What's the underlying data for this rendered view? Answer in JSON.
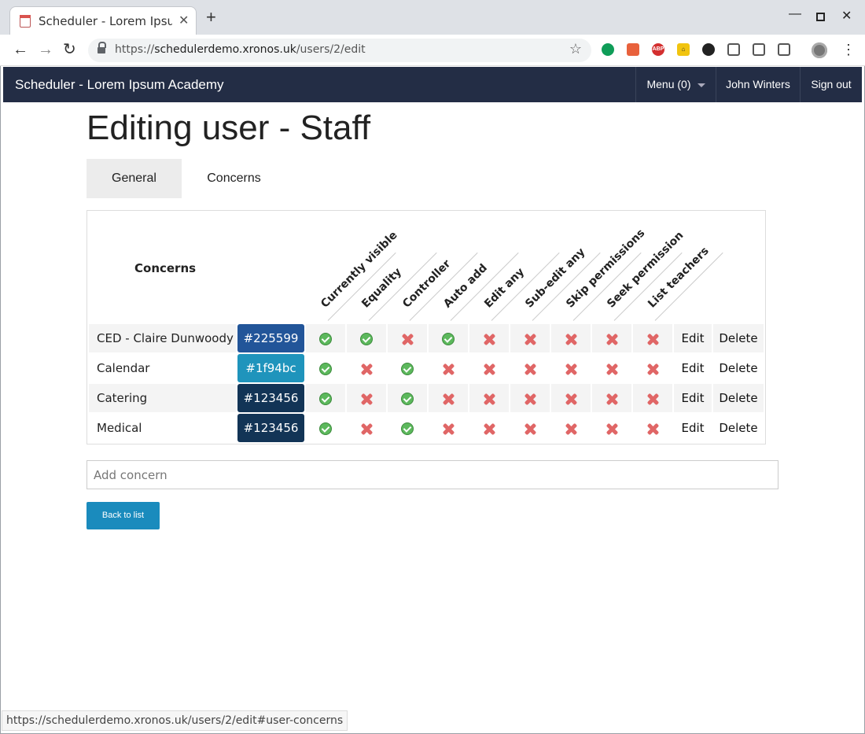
{
  "browser": {
    "tab_title": "Scheduler - Lorem Ipsum A",
    "url_scheme": "https://",
    "url_host": "schedulerdemo.xronos.uk",
    "url_path": "/users/2/edit",
    "status_url": "https://schedulerdemo.xronos.uk/users/2/edit#user-concerns",
    "extension_icons": [
      "evernote-icon",
      "pdf-icon",
      "adblock-icon",
      "house-icon",
      "paw-icon",
      "bulb-icon",
      "mail-icon",
      "screenshot-icon"
    ]
  },
  "navbar": {
    "brand": "Scheduler - Lorem Ipsum Academy",
    "menu_label": "Menu (0)",
    "user_label": "John Winters",
    "signout_label": "Sign out",
    "background": "#232d45"
  },
  "page": {
    "title": "Editing user - Staff",
    "tabs": [
      {
        "label": "General",
        "active": true
      },
      {
        "label": "Concerns",
        "active": false
      }
    ]
  },
  "concerns_table": {
    "header": "Concerns",
    "columns": [
      "Currently visible",
      "Equality",
      "Controller",
      "Auto add",
      "Edit any",
      "Sub-edit any",
      "Skip permissions",
      "Seek permission",
      "List teachers"
    ],
    "edit_label": "Edit",
    "delete_label": "Delete",
    "rows": [
      {
        "name": "CED - Claire Dunwoody",
        "color": "#225599",
        "flags": [
          true,
          true,
          false,
          true,
          false,
          false,
          false,
          false,
          false
        ]
      },
      {
        "name": "Calendar",
        "color": "#1f94bc",
        "flags": [
          true,
          false,
          true,
          false,
          false,
          false,
          false,
          false,
          false
        ]
      },
      {
        "name": "Catering",
        "color": "#123456",
        "flags": [
          true,
          false,
          true,
          false,
          false,
          false,
          false,
          false,
          false
        ]
      },
      {
        "name": "Medical",
        "color": "#123456",
        "flags": [
          true,
          false,
          true,
          false,
          false,
          false,
          false,
          false,
          false
        ]
      }
    ]
  },
  "add_concern": {
    "placeholder": "Add concern",
    "value": ""
  },
  "back_button": "Back to list"
}
